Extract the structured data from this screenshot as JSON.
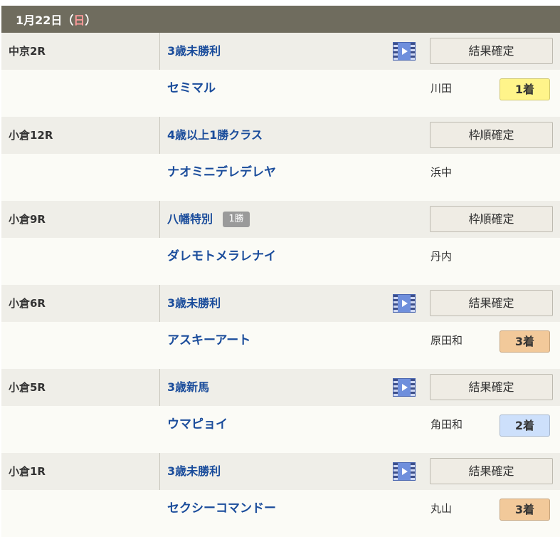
{
  "date": {
    "main": "1月22日（",
    "weekday": "日",
    "close": "）"
  },
  "status_colors": {
    "first": "#fff48a",
    "second": "#cde0fb",
    "third": "#f2c99a"
  },
  "races": [
    {
      "venue": "中京2R",
      "race_name": "3歳未勝利",
      "class_badge": "",
      "has_video": true,
      "status": "結果確定",
      "horse": "セミマル",
      "jockey": "川田",
      "result": "1着",
      "result_type": "first"
    },
    {
      "venue": "小倉12R",
      "race_name": "4歳以上1勝クラス",
      "class_badge": "",
      "has_video": false,
      "status": "枠順確定",
      "horse": "ナオミニデレデレヤ",
      "jockey": "浜中",
      "result": "",
      "result_type": ""
    },
    {
      "venue": "小倉9R",
      "race_name": "八幡特別",
      "class_badge": "1勝",
      "has_video": false,
      "status": "枠順確定",
      "horse": "ダレモトメラレナイ",
      "jockey": "丹内",
      "result": "",
      "result_type": ""
    },
    {
      "venue": "小倉6R",
      "race_name": "3歳未勝利",
      "class_badge": "",
      "has_video": true,
      "status": "結果確定",
      "horse": "アスキーアート",
      "jockey": "原田和",
      "result": "3着",
      "result_type": "third"
    },
    {
      "venue": "小倉5R",
      "race_name": "3歳新馬",
      "class_badge": "",
      "has_video": true,
      "status": "結果確定",
      "horse": "ウマピョイ",
      "jockey": "角田和",
      "result": "2着",
      "result_type": "second"
    },
    {
      "venue": "小倉1R",
      "race_name": "3歳未勝利",
      "class_badge": "",
      "has_video": true,
      "status": "結果確定",
      "horse": "セクシーコマンドー",
      "jockey": "丸山",
      "result": "3着",
      "result_type": "third"
    }
  ]
}
